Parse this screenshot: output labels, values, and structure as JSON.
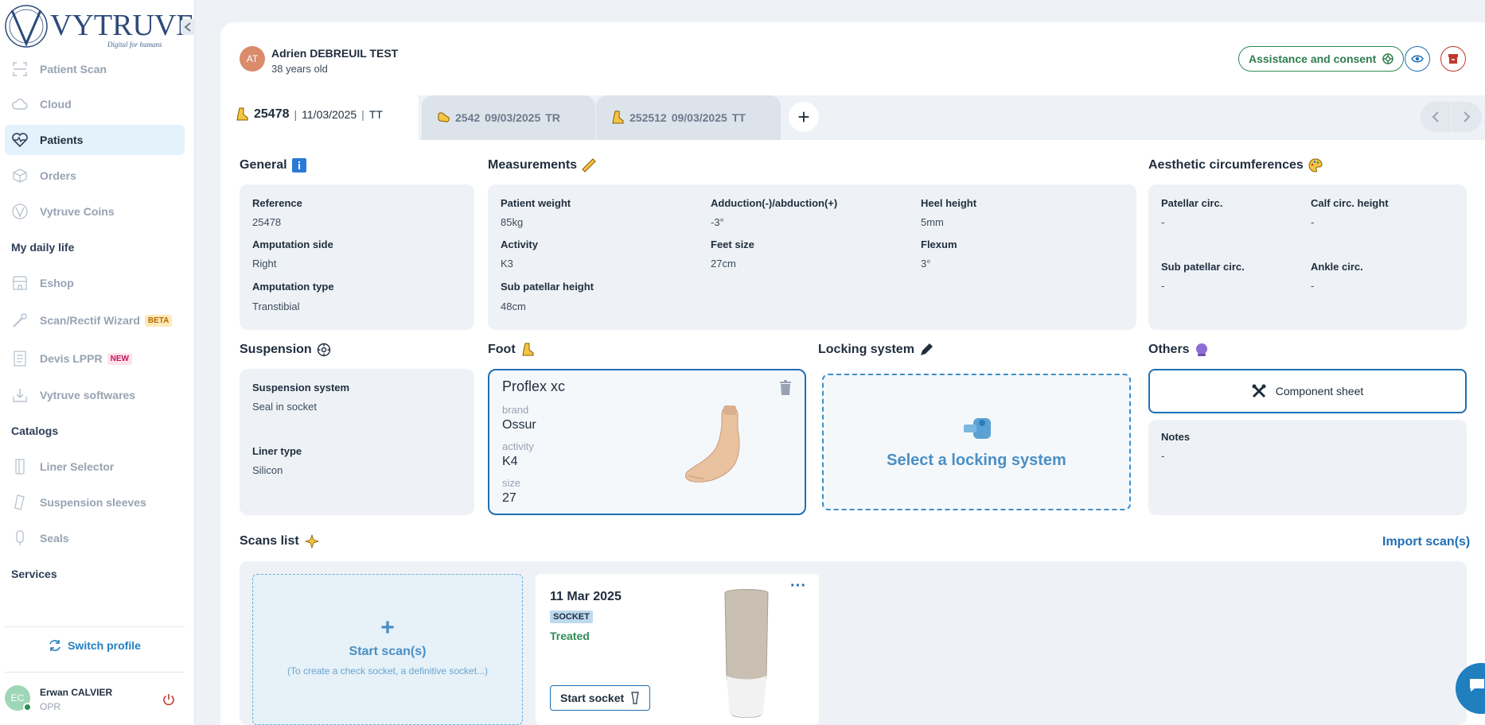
{
  "brand": {
    "name": "VYTRUVE",
    "tagline": "Digital for humans"
  },
  "sidebar": {
    "items": [
      {
        "label": "Patient Scan",
        "icon": "scan-icon"
      },
      {
        "label": "Cloud",
        "icon": "cloud-icon"
      },
      {
        "label": "Patients",
        "icon": "heartbeat-icon",
        "active": true
      },
      {
        "label": "Orders",
        "icon": "box-icon"
      },
      {
        "label": "Vytruve Coins",
        "icon": "coin-icon"
      }
    ],
    "section_daily": "My daily life",
    "daily_items": [
      {
        "label": "Eshop",
        "icon": "shop-icon"
      },
      {
        "label": "Scan/Rectif Wizard",
        "icon": "wand-icon",
        "badge": "BETA"
      },
      {
        "label": "Devis LPPR",
        "icon": "document-icon",
        "badge": "NEW"
      },
      {
        "label": "Vytruve softwares",
        "icon": "download-icon"
      }
    ],
    "section_catalogs": "Catalogs",
    "catalog_items": [
      {
        "label": "Liner Selector",
        "icon": "liner-icon"
      },
      {
        "label": "Suspension sleeves",
        "icon": "sleeve-icon"
      },
      {
        "label": "Seals",
        "icon": "seal-icon"
      }
    ],
    "section_services": "Services",
    "switch_profile": "Switch profile",
    "user": {
      "initials": "EC",
      "name": "Erwan CALVIER",
      "role": "OPR"
    }
  },
  "patient": {
    "initials": "AT",
    "name": "Adrien DEBREUIL TEST",
    "age": "38 years old",
    "consent_label": "Assistance and consent"
  },
  "tabs": [
    {
      "id": "25478",
      "sep1": "|",
      "date": "11/03/2025",
      "sep2": "|",
      "type": "TT"
    },
    {
      "id": "2542",
      "date": "09/03/2025",
      "type": "TR"
    },
    {
      "id": "252512",
      "date": "09/03/2025",
      "type": "TT"
    }
  ],
  "add_tab_label": "+",
  "general": {
    "title": "General",
    "reference_label": "Reference",
    "reference": "25478",
    "side_label": "Amputation side",
    "side": "Right",
    "type_label": "Amputation type",
    "type": "Transtibial"
  },
  "measurements": {
    "title": "Measurements",
    "weight_label": "Patient weight",
    "weight": "85kg",
    "adduction_label": "Adduction(-)/abduction(+)",
    "adduction": "-3°",
    "heel_label": "Heel height",
    "heel": "5mm",
    "activity_label": "Activity",
    "activity": "K3",
    "feet_label": "Feet size",
    "feet": "27cm",
    "flexum_label": "Flexum",
    "flexum": "3°",
    "subpatellar_label": "Sub patellar height",
    "subpatellar": "48cm"
  },
  "aesthetic": {
    "title": "Aesthetic circumferences",
    "patellar_label": "Patellar circ.",
    "patellar": "-",
    "calf_label": "Calf circ. height",
    "calf": "-",
    "subpatellar_label": "Sub patellar circ.",
    "subpatellar": "-",
    "ankle_label": "Ankle circ.",
    "ankle": "-"
  },
  "suspension": {
    "title": "Suspension",
    "system_label": "Suspension system",
    "system": "Seal in socket",
    "liner_label": "Liner type",
    "liner": "Silicon"
  },
  "foot": {
    "title": "Foot",
    "name": "Proflex xc",
    "brand_label": "brand",
    "brand": "Ossur",
    "activity_label": "activity",
    "activity": "K4",
    "size_label": "size",
    "size": "27"
  },
  "locking": {
    "title": "Locking system",
    "select_label": "Select a locking system"
  },
  "others": {
    "title": "Others",
    "component_sheet": "Component sheet",
    "notes_label": "Notes",
    "notes": "-"
  },
  "scans": {
    "title": "Scans list",
    "import_label": "Import scan(s)",
    "start_label": "Start scan(s)",
    "start_hint": "(To create a check socket, a definitive socket...)",
    "plus": "+",
    "card": {
      "date": "11 Mar 2025",
      "badge": "SOCKET",
      "status": "Treated",
      "button": "Start socket",
      "more": "···"
    }
  },
  "colors": {
    "accent": "#1f6fb3",
    "success": "#2e7d4f",
    "danger": "#c0392b",
    "active_bg": "#e3f2fb"
  }
}
